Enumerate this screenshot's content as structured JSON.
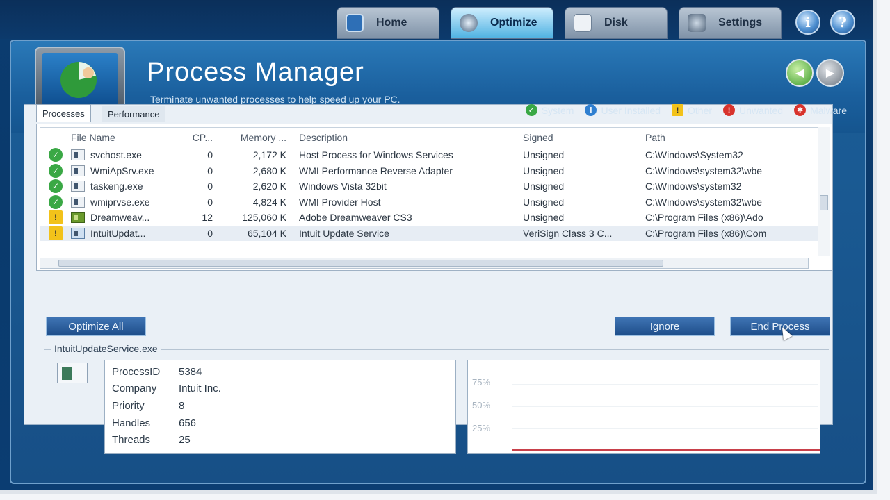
{
  "top_tabs": [
    {
      "label": "Home",
      "icon": "home-icon"
    },
    {
      "label": "Optimize",
      "icon": "optimize-icon"
    },
    {
      "label": "Disk",
      "icon": "disk-icon"
    },
    {
      "label": "Settings",
      "icon": "settings-icon"
    }
  ],
  "info_btn": "i",
  "help_btn": "?",
  "header": {
    "title": "Process Manager",
    "subtitle": "Terminate unwanted processes to help speed up your PC."
  },
  "sub_tabs": [
    "Processes",
    "Performance"
  ],
  "legend": [
    {
      "label": "System",
      "color": "#3aa845",
      "glyph": "✓"
    },
    {
      "label": "User Installed",
      "color": "#2f7fd0",
      "glyph": "i"
    },
    {
      "label": "Other",
      "color": "#f2c21a",
      "glyph": "!"
    },
    {
      "label": "Unwanted",
      "color": "#d8332c",
      "glyph": "!"
    },
    {
      "label": "Malware",
      "color": "#d8332c",
      "glyph": "✱"
    }
  ],
  "table": {
    "headers": [
      "File Name",
      "CP...",
      "Memory ...",
      "Description",
      "Signed",
      "Path"
    ],
    "rows": [
      {
        "status": "system",
        "file": "svchost.exe",
        "cpu": "0",
        "memory": "2,172 K",
        "description": "Host Process for Windows Services",
        "signed": "Unsigned",
        "path": "C:\\Windows\\System32"
      },
      {
        "status": "system",
        "file": "WmiApSrv.exe",
        "cpu": "0",
        "memory": "2,680 K",
        "description": "WMI Performance Reverse Adapter",
        "signed": "Unsigned",
        "path": "C:\\Windows\\system32\\wbe"
      },
      {
        "status": "system",
        "file": "taskeng.exe",
        "cpu": "0",
        "memory": "2,620 K",
        "description": "Windows Vista 32bit",
        "signed": "Unsigned",
        "path": "C:\\Windows\\system32"
      },
      {
        "status": "system",
        "file": "wmiprvse.exe",
        "cpu": "0",
        "memory": "4,824 K",
        "description": "WMI Provider Host",
        "signed": "Unsigned",
        "path": "C:\\Windows\\system32\\wbe"
      },
      {
        "status": "other",
        "file": "Dreamweav...",
        "cpu": "12",
        "memory": "125,060 K",
        "description": "Adobe Dreamweaver CS3",
        "signed": "Unsigned",
        "path": "C:\\Program Files (x86)\\Ado"
      },
      {
        "status": "other",
        "file": "IntuitUpdat...",
        "cpu": "0",
        "memory": "65,104 K",
        "description": "Intuit Update Service",
        "signed": "VeriSign Class 3 C...",
        "path": "C:\\Program Files (x86)\\Com"
      }
    ]
  },
  "buttons": {
    "optimize_all": "Optimize All",
    "ignore": "Ignore",
    "end_process": "End Process"
  },
  "detail": {
    "title": "IntuitUpdateService.exe",
    "fields": [
      {
        "key": "ProcessID",
        "value": "5384"
      },
      {
        "key": "Company",
        "value": "Intuit Inc."
      },
      {
        "key": "Priority",
        "value": "8"
      },
      {
        "key": "Handles",
        "value": "656"
      },
      {
        "key": "Threads",
        "value": "25"
      }
    ],
    "graph_labels": [
      "75%",
      "50%",
      "25%"
    ]
  },
  "colors": {
    "accent": "#1c5d97",
    "system": "#3aa845",
    "other": "#f2c21a",
    "graph_line": "#c8404a"
  }
}
